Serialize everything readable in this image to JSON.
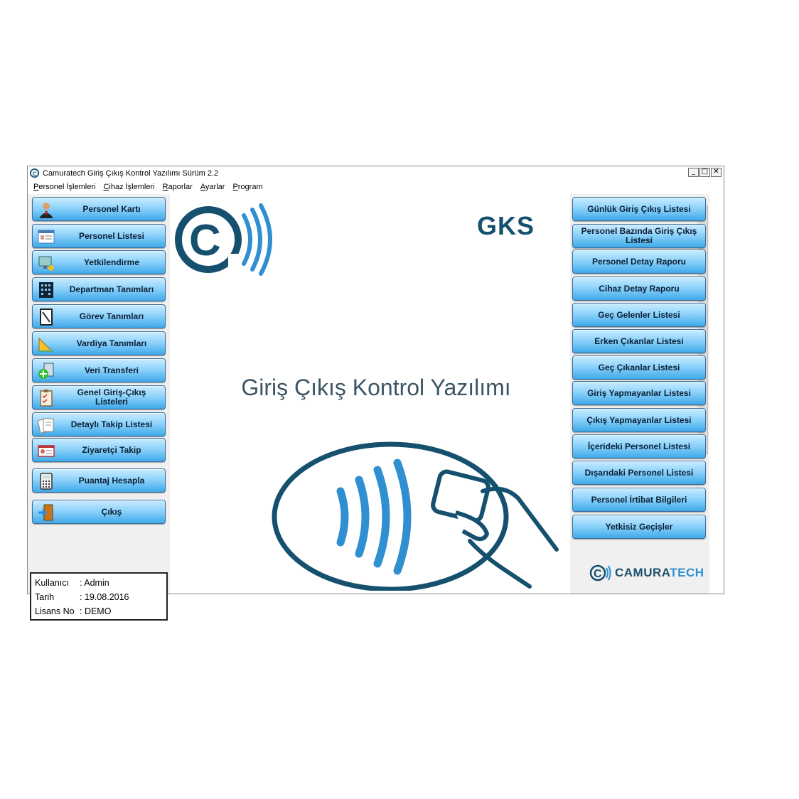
{
  "window": {
    "title": "Camuratech Giriş Çıkış Kontrol Yazılımı Sürüm 2.2",
    "controls": [
      "_",
      "□",
      "✕"
    ]
  },
  "menu": [
    "Personel İşlemleri",
    "Cihaz İşlemleri",
    "Raporlar",
    "Ayarlar",
    "Program"
  ],
  "left_buttons": [
    {
      "label": "Personel Kartı",
      "icon": "person-icon"
    },
    {
      "label": "Personel Listesi",
      "icon": "list-icon"
    },
    {
      "label": "Yetkilendirme",
      "icon": "key-computer-icon"
    },
    {
      "label": "Departman Tanımları",
      "icon": "building-icon"
    },
    {
      "label": "Görev Tanımları",
      "icon": "clipboard-icon"
    },
    {
      "label": "Vardiya Tanımları",
      "icon": "ruler-icon"
    },
    {
      "label": "Veri Transferi",
      "icon": "transfer-icon"
    },
    {
      "label": "Genel Giriş-Çıkış Listeleri",
      "icon": "checklist-icon"
    },
    {
      "label": "Detaylı Takip Listesi",
      "icon": "documents-icon"
    },
    {
      "label": "Ziyaretçi Takip",
      "icon": "id-card-icon"
    },
    {
      "label": "Puantaj Hesapla",
      "icon": "calculator-icon"
    },
    {
      "label": "Çıkış",
      "icon": "exit-door-icon"
    }
  ],
  "right_buttons": [
    "Günlük Giriş Çıkış Listesi",
    "Personel Bazında Giriş Çıkış Listesi",
    "Personel Detay Raporu",
    "Cihaz Detay Raporu",
    "Geç Gelenler Listesi",
    "Erken Çıkanlar Listesi",
    "Geç Çıkanlar Listesi",
    "Giriş Yapmayanlar Listesi",
    "Çıkış Yapmayanlar Listesi",
    "İçerideki Personel Listesi",
    "Dışarıdaki Personel Listesi",
    "Personel İrtibat Bilgileri",
    "Yetkisiz Geçişler"
  ],
  "info": {
    "user_label": "Kullanıcı",
    "user_value": ": Admin",
    "date_label": "Tarih",
    "date_value": ": 19.08.2016",
    "license_label": "Lisans No",
    "license_value": ": DEMO"
  },
  "main": {
    "gks": "GKS",
    "title": "Giriş Çıkış Kontrol Yazılımı"
  },
  "brand": {
    "part1": "CAMURA",
    "part2": "TECH"
  },
  "colors": {
    "brand_dark": "#15506e",
    "brand_blue": "#2f8fd0",
    "button_top": "#c9ecff",
    "button_bottom": "#3fa9ea"
  }
}
